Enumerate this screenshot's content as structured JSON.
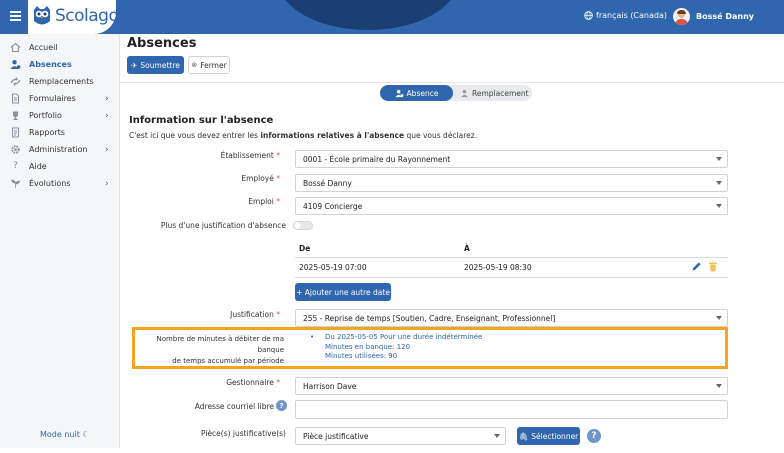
{
  "brand": {
    "name": "Scolago"
  },
  "header": {
    "language": "français (Canada)",
    "user_name": "Bossé Danny"
  },
  "sidebar": {
    "items": [
      {
        "label": "Accueil",
        "icon": "home-icon",
        "has_submenu": false,
        "active": false
      },
      {
        "label": "Absences",
        "icon": "user-absence-icon",
        "has_submenu": false,
        "active": true
      },
      {
        "label": "Remplacements",
        "icon": "exchange-icon",
        "has_submenu": false,
        "active": false
      },
      {
        "label": "Formulaires",
        "icon": "file-icon",
        "has_submenu": true,
        "active": false
      },
      {
        "label": "Portfolio",
        "icon": "trophy-icon",
        "has_submenu": true,
        "active": false
      },
      {
        "label": "Rapports",
        "icon": "report-icon",
        "has_submenu": false,
        "active": false
      },
      {
        "label": "Administration",
        "icon": "gear-icon",
        "has_submenu": true,
        "active": false
      },
      {
        "label": "Aide",
        "icon": "question-icon",
        "has_submenu": false,
        "active": false
      },
      {
        "label": "Évolutions",
        "icon": "sprout-icon",
        "has_submenu": true,
        "active": false
      }
    ],
    "night_mode": "Mode nuit"
  },
  "page": {
    "title": "Absences",
    "submit_label": "Soumettre",
    "close_label": "Fermer",
    "steps": [
      {
        "label": "Absence",
        "active": true
      },
      {
        "label": "Remplacement",
        "active": false
      }
    ]
  },
  "form": {
    "section_title": "Information sur l'absence",
    "desc_before": "C'est ici que vous devez entrer les ",
    "desc_bold": "informations relatives à l'absence",
    "desc_after": " que vous déclarez.",
    "etablissement": {
      "label": "Établissement",
      "value": "0001 - École primaire du Rayonnement"
    },
    "employe": {
      "label": "Employé",
      "value": "Bossé Danny"
    },
    "emploi": {
      "label": "Emploi",
      "value": "4109 Concierge"
    },
    "multi_justification": {
      "label": "Plus d'une justification d'absence",
      "checked": false
    },
    "dates": {
      "col_from": "De",
      "col_to": "À",
      "rows": [
        {
          "from": "2025-05-19 07:00",
          "to": "2025-05-19 08:30"
        }
      ],
      "add_label": "+ Ajouter une autre date"
    },
    "justification": {
      "label": "Justification",
      "value": "255 - Reprise de temps [Soutien, Cadre, Enseignant, Professionnel]"
    },
    "bank": {
      "label_line1": "Nombre de minutes à débiter de ma banque",
      "label_line2": "de temps accumulé par période",
      "line1": "Du 2025-05-05 Pour une durée indéterminée",
      "line2": "Minutes en banque: 120",
      "line3": "Minutes utilisées: 90"
    },
    "gestionnaire": {
      "label": "Gestionnaire",
      "value": "Harrison Dave"
    },
    "email": {
      "label": "Adresse courriel libre",
      "value": ""
    },
    "pieces": {
      "label": "Pièce(s) justificative(s)",
      "value": "Pièce justificative",
      "select_label": "Sélectionner"
    }
  },
  "colors": {
    "primary": "#2f66ad",
    "highlight": "#f2a51e",
    "required": "#d9534f"
  }
}
